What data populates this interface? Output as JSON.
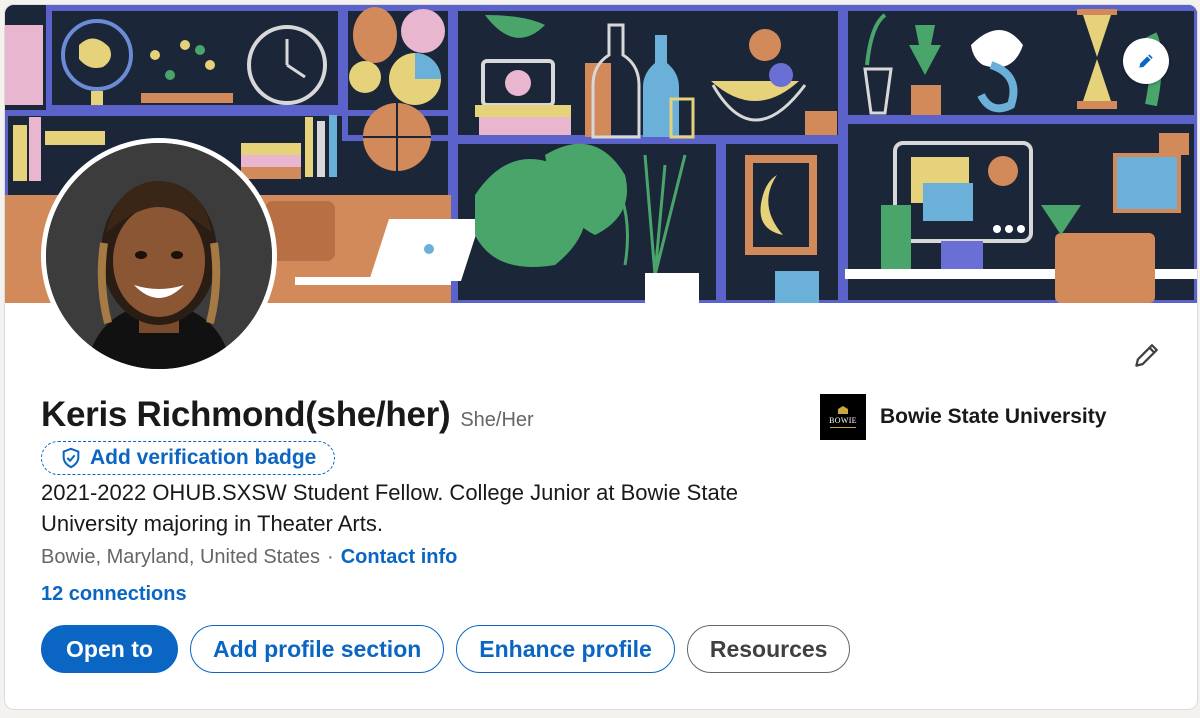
{
  "profile": {
    "name": "Keris Richmond",
    "name_pronouns": "(she/her)",
    "pronouns": "She/Her",
    "verification_label": "Add verification badge",
    "headline": "2021-2022 OHUB.SXSW Student Fellow. College Junior at Bowie State University majoring in Theater Arts.",
    "location": "Bowie, Maryland, United States",
    "separator": "·",
    "contact_info": "Contact info",
    "connections": "12 connections"
  },
  "actions": {
    "open_to": "Open to",
    "add_section": "Add profile section",
    "enhance": "Enhance profile",
    "resources": "Resources"
  },
  "education": {
    "school": "Bowie State University",
    "logo_text": "BOWIE"
  },
  "colors": {
    "accent": "#0a66c2",
    "cover_background": "#1b2638"
  },
  "icons": {
    "cover_edit": "pencil-icon",
    "profile_edit": "pencil-icon",
    "verification": "shield-check-icon"
  }
}
